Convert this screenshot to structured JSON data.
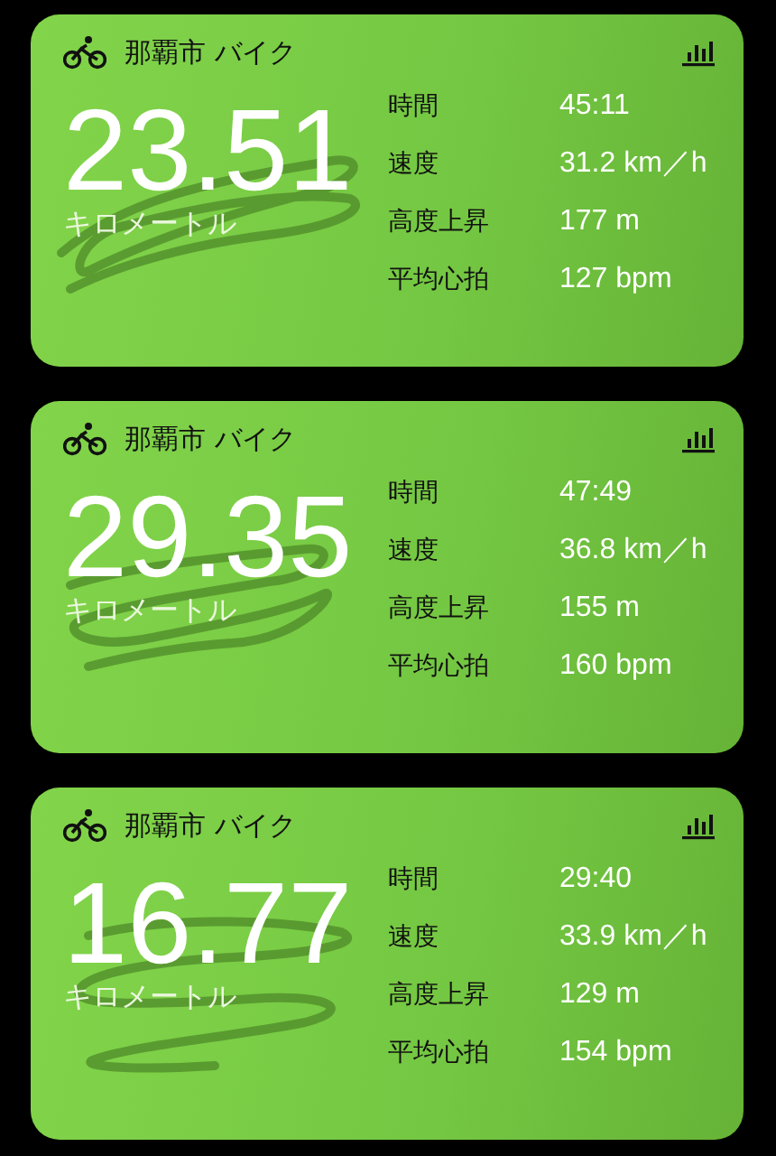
{
  "workouts": [
    {
      "title": "那覇市 バイク",
      "distance": "23.51",
      "unit": "キロメートル",
      "stats": [
        {
          "label": "時間",
          "value": "45:11"
        },
        {
          "label": "速度",
          "value": "31.2 km／h"
        },
        {
          "label": "高度上昇",
          "value": "177 m"
        },
        {
          "label": "平均心拍",
          "value": "127 bpm"
        }
      ]
    },
    {
      "title": "那覇市 バイク",
      "distance": "29.35",
      "unit": "キロメートル",
      "stats": [
        {
          "label": "時間",
          "value": "47:49"
        },
        {
          "label": "速度",
          "value": "36.8 km／h"
        },
        {
          "label": "高度上昇",
          "value": "155 m"
        },
        {
          "label": "平均心拍",
          "value": "160 bpm"
        }
      ]
    },
    {
      "title": "那覇市 バイク",
      "distance": "16.77",
      "unit": "キロメートル",
      "stats": [
        {
          "label": "時間",
          "value": "29:40"
        },
        {
          "label": "速度",
          "value": "33.9 km／h"
        },
        {
          "label": "高度上昇",
          "value": "129 m"
        },
        {
          "label": "平均心拍",
          "value": "154 bpm"
        }
      ]
    }
  ]
}
